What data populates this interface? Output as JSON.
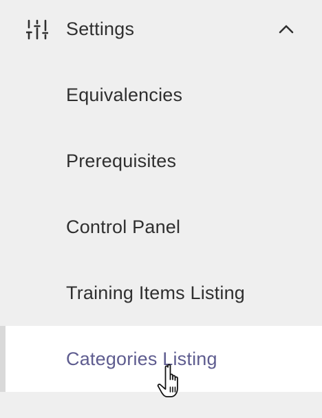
{
  "settings": {
    "title": "Settings",
    "icon": "sliders-icon",
    "expanded": true
  },
  "nav": {
    "items": [
      {
        "label": "Equivalencies"
      },
      {
        "label": "Prerequisites"
      },
      {
        "label": "Control Panel"
      },
      {
        "label": "Training Items Listing"
      },
      {
        "label": "Categories Listing",
        "active": true
      }
    ]
  },
  "colors": {
    "background": "#efefef",
    "active_background": "#ffffff",
    "active_text": "#5e5c8f",
    "text": "#2f2f2f"
  }
}
